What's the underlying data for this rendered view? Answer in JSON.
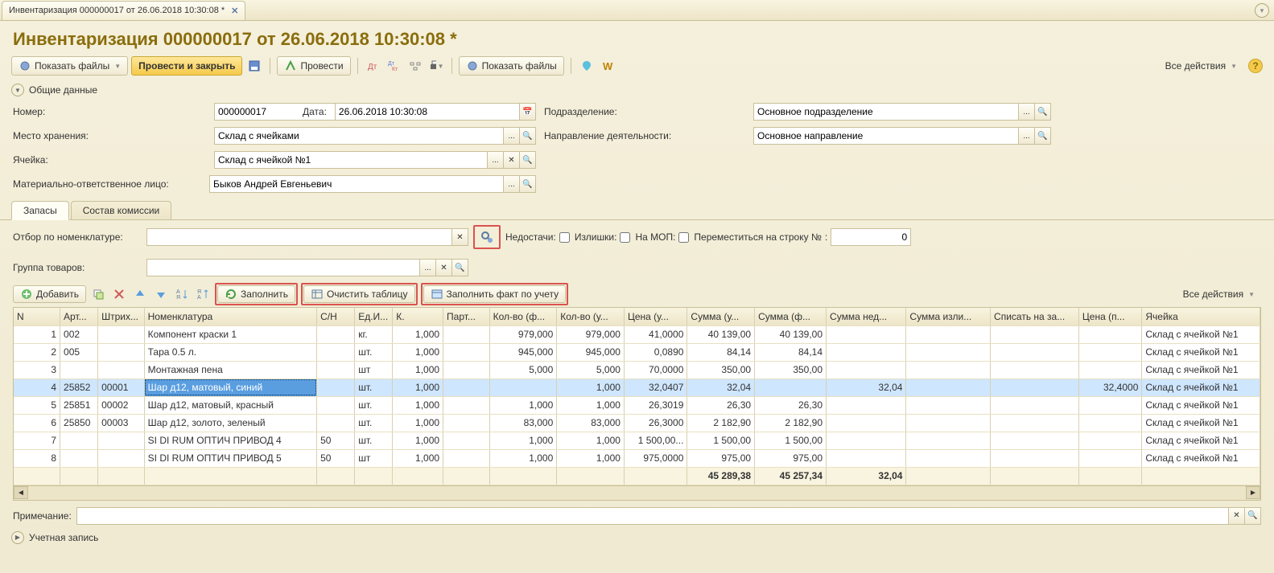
{
  "tab_title": "Инвентаризация 000000017 от 26.06.2018 10:30:08 *",
  "page_title": "Инвентаризация 000000017 от 26.06.2018 10:30:08 *",
  "toolbar": {
    "show_files": "Показать файлы",
    "post_close": "Провести и закрыть",
    "post": "Провести",
    "show_files2": "Показать файлы",
    "all_actions": "Все действия"
  },
  "sections": {
    "general": "Общие данные",
    "account": "Учетная запись"
  },
  "fields": {
    "number_label": "Номер:",
    "number_value": "000000017",
    "date_label": "Дата:",
    "date_value": "26.06.2018 10:30:08",
    "storage_label": "Место хранения:",
    "storage_value": "Склад с ячейками",
    "cell_label": "Ячейка:",
    "cell_value": "Склад с ячейкой №1",
    "mol_label": "Материально-ответственное лицо:",
    "mol_value": "Быков Андрей Евгеньевич",
    "division_label": "Подразделение:",
    "division_value": "Основное подразделение",
    "activity_label": "Направление деятельности:",
    "activity_value": "Основное направление"
  },
  "sub_tabs": {
    "stocks": "Запасы",
    "commission": "Состав комиссии"
  },
  "filters": {
    "nomenclature_label": "Отбор по номенклатуре:",
    "group_label": "Группа товаров:",
    "shortages": "Недостачи:",
    "surplus": "Излишки:",
    "on_mol": "На МОП:",
    "goto_row": "Переместиться на строку №",
    "goto_value": "0"
  },
  "table_toolbar": {
    "add": "Добавить",
    "fill": "Заполнить",
    "clear": "Очистить таблицу",
    "fill_fact": "Заполнить факт по учету",
    "all_actions": "Все действия"
  },
  "columns": [
    "N",
    "Арт...",
    "Штрих...",
    "Номенклатура",
    "С/Н",
    "Ед.И...",
    "К.",
    "Парт...",
    "Кол-во (ф...",
    "Кол-во (у...",
    "Цена (у...",
    "Сумма (у...",
    "Сумма (ф...",
    "Сумма нед...",
    "Сумма изли...",
    "Списать на за...",
    "Цена (п...",
    "Ячейка"
  ],
  "rows": [
    {
      "n": "1",
      "art": "002",
      "bar": "",
      "nom": "Компонент краски 1",
      "sn": "",
      "unit": "кг.",
      "k": "1,000",
      "lot": "",
      "qf": "979,000",
      "qu": "979,000",
      "pu": "41,0000",
      "su": "40 139,00",
      "sf": "40 139,00",
      "snd": "",
      "ssp": "",
      "spi": "",
      "pp": "",
      "cell": "Склад с ячейкой №1"
    },
    {
      "n": "2",
      "art": "005",
      "bar": "",
      "nom": "Тара 0.5 л.",
      "sn": "",
      "unit": "шт.",
      "k": "1,000",
      "lot": "",
      "qf": "945,000",
      "qu": "945,000",
      "pu": "0,0890",
      "su": "84,14",
      "sf": "84,14",
      "snd": "",
      "ssp": "",
      "spi": "",
      "pp": "",
      "cell": "Склад с ячейкой №1"
    },
    {
      "n": "3",
      "art": "",
      "bar": "",
      "nom": "Монтажная пена",
      "sn": "",
      "unit": "шт",
      "k": "1,000",
      "lot": "",
      "qf": "5,000",
      "qu": "5,000",
      "pu": "70,0000",
      "su": "350,00",
      "sf": "350,00",
      "snd": "",
      "ssp": "",
      "spi": "",
      "pp": "",
      "cell": "Склад с ячейкой №1"
    },
    {
      "n": "4",
      "art": "25852",
      "bar": "00001",
      "nom": "Шар д12, матовый, синий",
      "sn": "",
      "unit": "шт.",
      "k": "1,000",
      "lot": "",
      "qf": "",
      "qu": "1,000",
      "pu": "32,0407",
      "su": "32,04",
      "sf": "",
      "snd": "32,04",
      "ssp": "",
      "spi": "",
      "pp": "32,4000",
      "cell": "Склад с ячейкой №1",
      "selected": true
    },
    {
      "n": "5",
      "art": "25851",
      "bar": "00002",
      "nom": "Шар д12, матовый, красный",
      "sn": "",
      "unit": "шт.",
      "k": "1,000",
      "lot": "",
      "qf": "1,000",
      "qu": "1,000",
      "pu": "26,3019",
      "su": "26,30",
      "sf": "26,30",
      "snd": "",
      "ssp": "",
      "spi": "",
      "pp": "",
      "cell": "Склад с ячейкой №1"
    },
    {
      "n": "6",
      "art": "25850",
      "bar": "00003",
      "nom": "Шар д12, золото, зеленый",
      "sn": "",
      "unit": "шт.",
      "k": "1,000",
      "lot": "",
      "qf": "83,000",
      "qu": "83,000",
      "pu": "26,3000",
      "su": "2 182,90",
      "sf": "2 182,90",
      "snd": "",
      "ssp": "",
      "spi": "",
      "pp": "",
      "cell": "Склад с ячейкой №1"
    },
    {
      "n": "7",
      "art": "",
      "bar": "",
      "nom": "SI DI RUM ОПТИЧ ПРИВОД 4",
      "sn": "50",
      "unit": "шт.",
      "k": "1,000",
      "lot": "",
      "qf": "1,000",
      "qu": "1,000",
      "pu": "1 500,00...",
      "su": "1 500,00",
      "sf": "1 500,00",
      "snd": "",
      "ssp": "",
      "spi": "",
      "pp": "",
      "cell": "Склад с ячейкой №1"
    },
    {
      "n": "8",
      "art": "",
      "bar": "",
      "nom": "SI DI RUM ОПТИЧ ПРИВОД 5",
      "sn": "50",
      "unit": "шт",
      "k": "1,000",
      "lot": "",
      "qf": "1,000",
      "qu": "1,000",
      "pu": "975,0000",
      "su": "975,00",
      "sf": "975,00",
      "snd": "",
      "ssp": "",
      "spi": "",
      "pp": "",
      "cell": "Склад с ячейкой №1"
    }
  ],
  "totals": {
    "su": "45 289,38",
    "sf": "45 257,34",
    "snd": "32,04"
  },
  "note_label": "Примечание:"
}
